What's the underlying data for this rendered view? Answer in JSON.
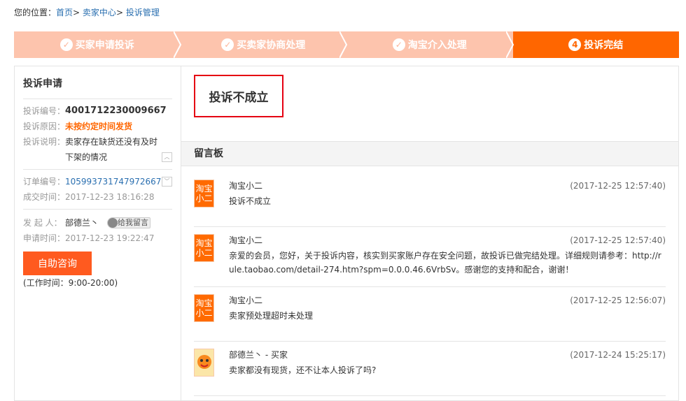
{
  "breadcrumb": {
    "label": "您的位置：",
    "items": [
      "首页",
      "卖家中心",
      "投诉管理"
    ],
    "sep": ">"
  },
  "steps": [
    {
      "icon": "✓",
      "label": "买家申请投诉"
    },
    {
      "icon": "✓",
      "label": "买卖家协商处理"
    },
    {
      "icon": "✓",
      "label": "淘宝介入处理"
    },
    {
      "icon": "4",
      "label": "投诉完结"
    }
  ],
  "complaint": {
    "title": "投诉申请",
    "id_label": "投诉编号：",
    "id": "4001712230009667",
    "reason_label": "投诉原因：",
    "reason": "未按约定时间发货",
    "desc_label": "投诉说明：",
    "desc": "卖家存在缺货还没有及时下架的情况",
    "order_label": "订单编号：",
    "order": "105993731747972667",
    "deal_label": "成交时间：",
    "deal_time": "2017-12-23 18:16:28",
    "initiator_label": "发 起 人：",
    "initiator": "部德兰丶",
    "msg_btn": "给我留言",
    "apply_label": "申请时间：",
    "apply_time": "2017-12-23 19:22:47",
    "consult_btn": "自助咨询",
    "hours": "(工作时间：9:00-20:00)"
  },
  "result": "投诉不成立",
  "board": {
    "title": "留言板",
    "messages": [
      {
        "avatar": [
          "淘宝",
          "小二"
        ],
        "author": "淘宝小二",
        "time": "(2017-12-25 12:57:40)",
        "text": "投诉不成立"
      },
      {
        "avatar": [
          "淘宝",
          "小二"
        ],
        "author": "淘宝小二",
        "time": "(2017-12-25 12:57:40)",
        "text": "亲爱的会员，您好，关于投诉内容，核实到买家账户存在安全问题，故投诉已做完结处理。详细规则请参考：http://rule.taobao.com/detail-274.htm?spm=0.0.0.46.6VrbSv。感谢您的支持和配合，谢谢！"
      },
      {
        "avatar": [
          "淘宝",
          "小二"
        ],
        "author": "淘宝小二",
        "time": "(2017-12-25 12:56:07)",
        "text": "卖家预处理超时未处理"
      },
      {
        "avatar": null,
        "author": "部德兰丶 - 买家",
        "time": "(2017-12-24 15:25:17)",
        "text": "卖家都没有现货，还不让本人投诉了吗?"
      }
    ]
  }
}
